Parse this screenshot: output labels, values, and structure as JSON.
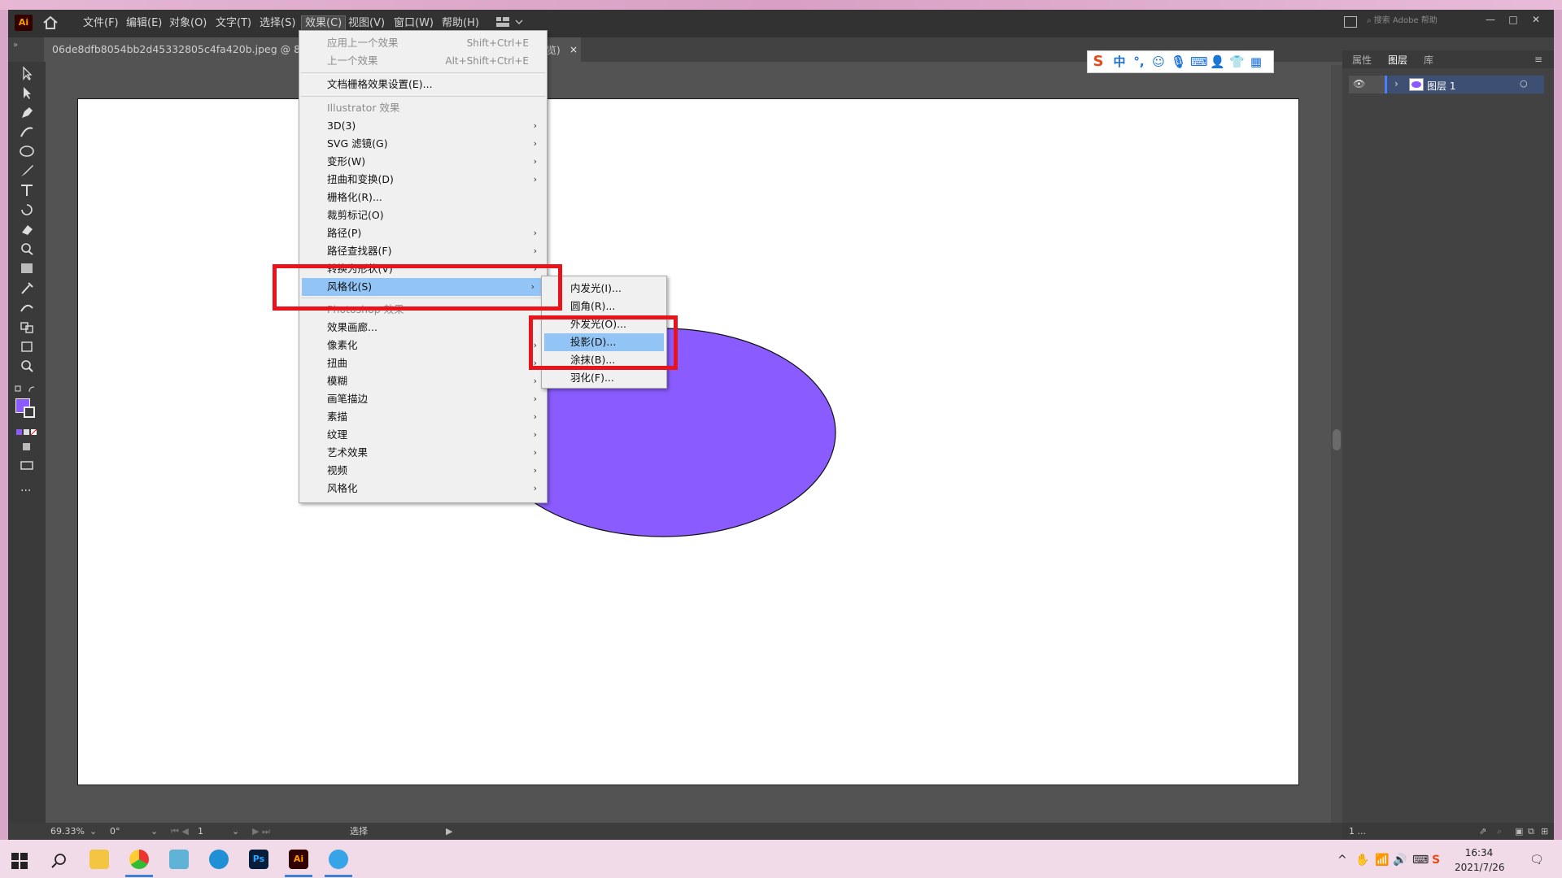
{
  "app": {
    "logo": "Ai",
    "search_placeholder": "搜索 Adobe 帮助"
  },
  "menubar": {
    "items": [
      "文件(F)",
      "编辑(E)",
      "对象(O)",
      "文字(T)",
      "选择(S)",
      "效果(C)",
      "视图(V)",
      "窗口(W)",
      "帮助(H)"
    ],
    "active": "效果(C)"
  },
  "window_controls": {
    "minimize": "—",
    "restore": "□",
    "close": "✕"
  },
  "document_tab": {
    "title": "06de8dfb8054bb2d45332805c4fa420b.jpeg @ 88.8",
    "tail": "览)",
    "close": "×"
  },
  "effect_menu": {
    "apply_last": {
      "label": "应用上一个效果",
      "shortcut": "Shift+Ctrl+E"
    },
    "last_effect": {
      "label": "上一个效果",
      "shortcut": "Alt+Shift+Ctrl+E"
    },
    "raster_settings": "文档栅格效果设置(E)...",
    "illustrator_header": "Illustrator 效果",
    "illustrator_items": [
      {
        "label": "3D(3)",
        "arrow": true
      },
      {
        "label": "SVG 滤镜(G)",
        "arrow": true
      },
      {
        "label": "变形(W)",
        "arrow": true
      },
      {
        "label": "扭曲和变换(D)",
        "arrow": true
      },
      {
        "label": "栅格化(R)...",
        "arrow": false
      },
      {
        "label": "裁剪标记(O)",
        "arrow": false
      },
      {
        "label": "路径(P)",
        "arrow": true
      },
      {
        "label": "路径查找器(F)",
        "arrow": true
      },
      {
        "label": "转换为形状(V)",
        "arrow": true
      },
      {
        "label": "风格化(S)",
        "arrow": true,
        "highlighted": true
      }
    ],
    "photoshop_header": "Photoshop 效果",
    "photoshop_items": [
      {
        "label": "效果画廊...",
        "arrow": false
      },
      {
        "label": "像素化",
        "arrow": true
      },
      {
        "label": "扭曲",
        "arrow": true
      },
      {
        "label": "模糊",
        "arrow": true
      },
      {
        "label": "画笔描边",
        "arrow": true
      },
      {
        "label": "素描",
        "arrow": true
      },
      {
        "label": "纹理",
        "arrow": true
      },
      {
        "label": "艺术效果",
        "arrow": true
      },
      {
        "label": "视频",
        "arrow": true
      },
      {
        "label": "风格化",
        "arrow": true
      }
    ]
  },
  "stylize_submenu": {
    "items": [
      "内发光(I)...",
      "圆角(R)...",
      "外发光(O)...",
      "投影(D)...",
      "涂抹(B)...",
      "羽化(F)..."
    ],
    "highlighted": "投影(D)..."
  },
  "right_panel": {
    "tabs": [
      "属性",
      "图层",
      "库"
    ],
    "active_tab": "图层",
    "layer_name": "图层 1",
    "bottom_label": "1 ..."
  },
  "statusbar": {
    "zoom": "69.33%",
    "rotation": "0°",
    "artboard": "1",
    "tool": "选择"
  },
  "ime": {
    "label": "中"
  },
  "taskbar": {
    "time": "16:34",
    "date": "2021/7/26"
  },
  "colors": {
    "ellipse_fill": "#8a5cff",
    "highlight": "#92c5f5",
    "annotation": "#e8131b"
  }
}
